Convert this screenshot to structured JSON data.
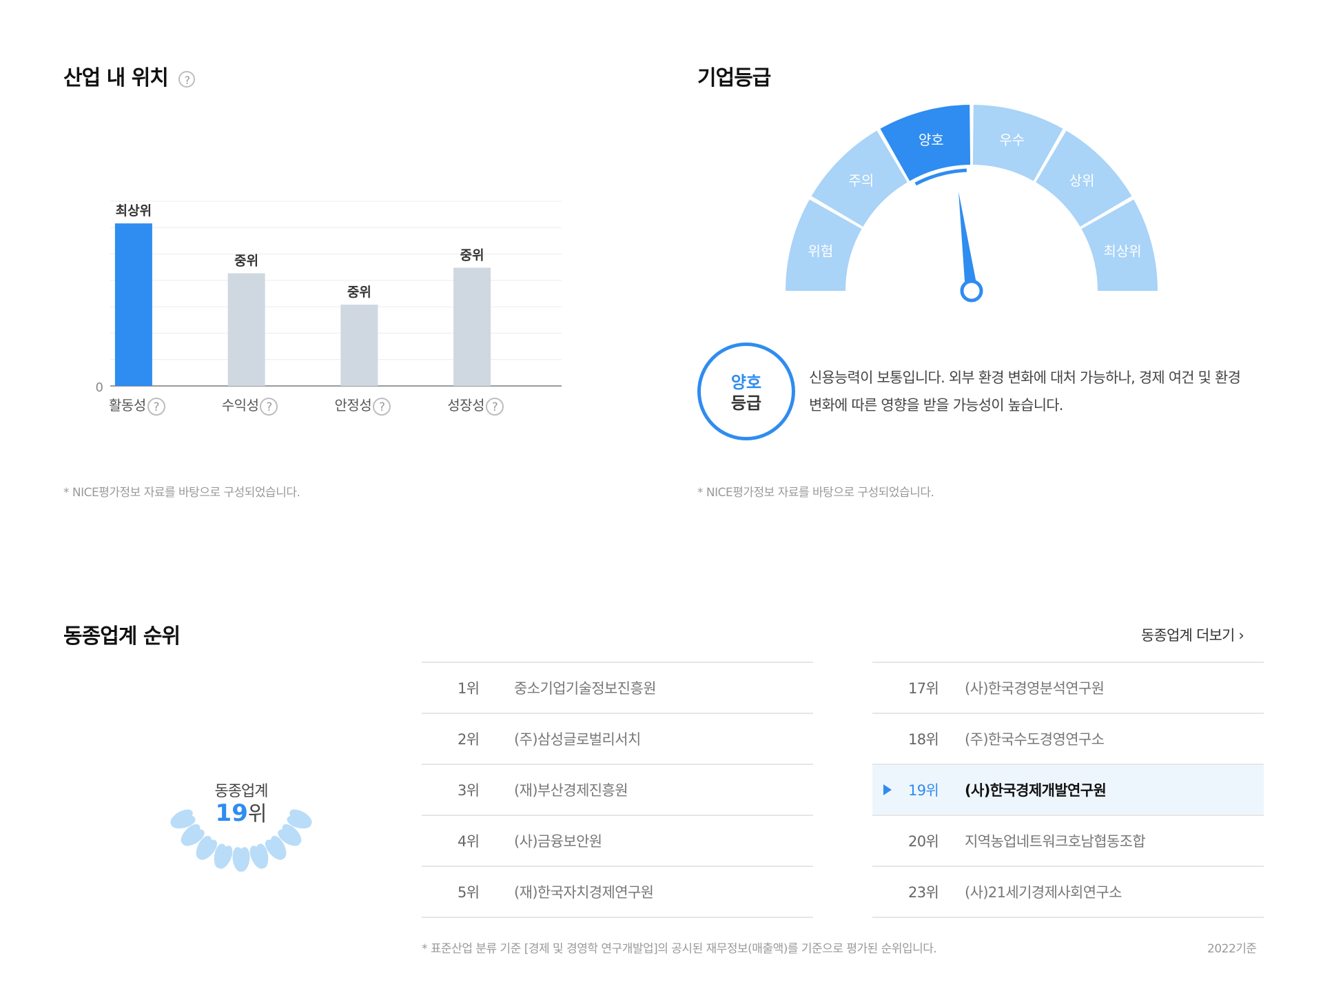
{
  "industry_position": {
    "title": "산업 내 위치",
    "help_icon": "?",
    "footnote": "* NICE평가정보 자료를 바탕으로 구성되었습니다."
  },
  "chart_data": {
    "type": "bar",
    "categories": [
      "활동성",
      "수익성",
      "안정성",
      "성장성"
    ],
    "values": [
      0.88,
      0.61,
      0.44,
      0.64
    ],
    "data_labels": [
      "최상위",
      "중위",
      "중위",
      "중위"
    ],
    "ylim": [
      0,
      1
    ],
    "y_tick_labels": [
      "0"
    ],
    "highlight_index": 0,
    "highlight_color": "#2f8cf0",
    "bar_color": "#cfd8e1",
    "grid": true
  },
  "credit_grade": {
    "title": "기업등급",
    "segments": [
      "위험",
      "주의",
      "양호",
      "우수",
      "상위",
      "최상위"
    ],
    "active_index": 2,
    "active_color": "#2f8cf0",
    "inactive_color": "#a9d3f7",
    "grade_label_top": "양호",
    "grade_label_bottom": "등급",
    "description": "신용능력이 보통입니다. 외부 환경 변화에 대처 가능하나, 경제 여건 및 환경 변화에 따른 영향을 받을 가능성이 높습니다.",
    "footnote": "* NICE평가정보 자료를 바탕으로 구성되었습니다."
  },
  "peer_ranking": {
    "title": "동종업계 순위",
    "more_link": "동종업계 더보기 ›",
    "badge_label": "동종업계",
    "badge_rank": "19",
    "badge_rank_suffix": "위",
    "left_list": [
      {
        "rank": "1위",
        "name": "중소기업기술정보진흥원"
      },
      {
        "rank": "2위",
        "name": "(주)삼성글로벌리서치"
      },
      {
        "rank": "3위",
        "name": "(재)부산경제진흥원"
      },
      {
        "rank": "4위",
        "name": "(사)금융보안원"
      },
      {
        "rank": "5위",
        "name": "(재)한국자치경제연구원"
      }
    ],
    "right_list": [
      {
        "rank": "17위",
        "name": "(사)한국경영분석연구원"
      },
      {
        "rank": "18위",
        "name": "(주)한국수도경영연구소"
      },
      {
        "rank": "19위",
        "name": "(사)한국경제개발연구원"
      },
      {
        "rank": "20위",
        "name": "지역농업네트워크호남협동조합"
      },
      {
        "rank": "23위",
        "name": "(사)21세기경제사회연구소"
      }
    ],
    "active_right_index": 2,
    "footnote": "* 표준산업 분류 기준 [경제 및 경영학 연구개발업]의 공시된 재무정보(매출액)를 기준으로 평가된 순위입니다.",
    "basis_year": "2022기준"
  }
}
